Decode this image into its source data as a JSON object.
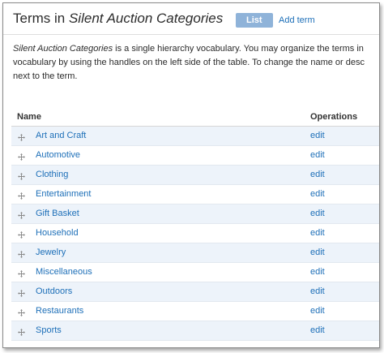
{
  "header": {
    "title_prefix": "Terms in ",
    "title_vocabulary": "Silent Auction Categories",
    "tabs": [
      {
        "label": "List",
        "active": true
      },
      {
        "label": "Add term",
        "active": false
      }
    ]
  },
  "description": {
    "vocabulary": "Silent Auction Categories",
    "line1_rest": " is a single hierarchy vocabulary. You may organize the terms in",
    "line2": "vocabulary by using the handles on the left side of the table. To change the name or desc",
    "line3": "next to the term."
  },
  "table": {
    "columns": [
      "Name",
      "Operations"
    ],
    "rows": [
      {
        "name": "Art and Craft",
        "operation": "edit"
      },
      {
        "name": "Automotive",
        "operation": "edit"
      },
      {
        "name": "Clothing",
        "operation": "edit"
      },
      {
        "name": "Entertainment",
        "operation": "edit"
      },
      {
        "name": "Gift Basket",
        "operation": "edit"
      },
      {
        "name": "Household",
        "operation": "edit"
      },
      {
        "name": "Jewelry",
        "operation": "edit"
      },
      {
        "name": "Miscellaneous",
        "operation": "edit"
      },
      {
        "name": "Outdoors",
        "operation": "edit"
      },
      {
        "name": "Restaurants",
        "operation": "edit"
      },
      {
        "name": "Sports",
        "operation": "edit"
      }
    ]
  },
  "icons": {
    "drag_handle": "drag-handle-icon"
  },
  "colors": {
    "link": "#1d6fb8",
    "active_tab": "#8fb3d9",
    "row_stripe": "#edf3fa"
  }
}
